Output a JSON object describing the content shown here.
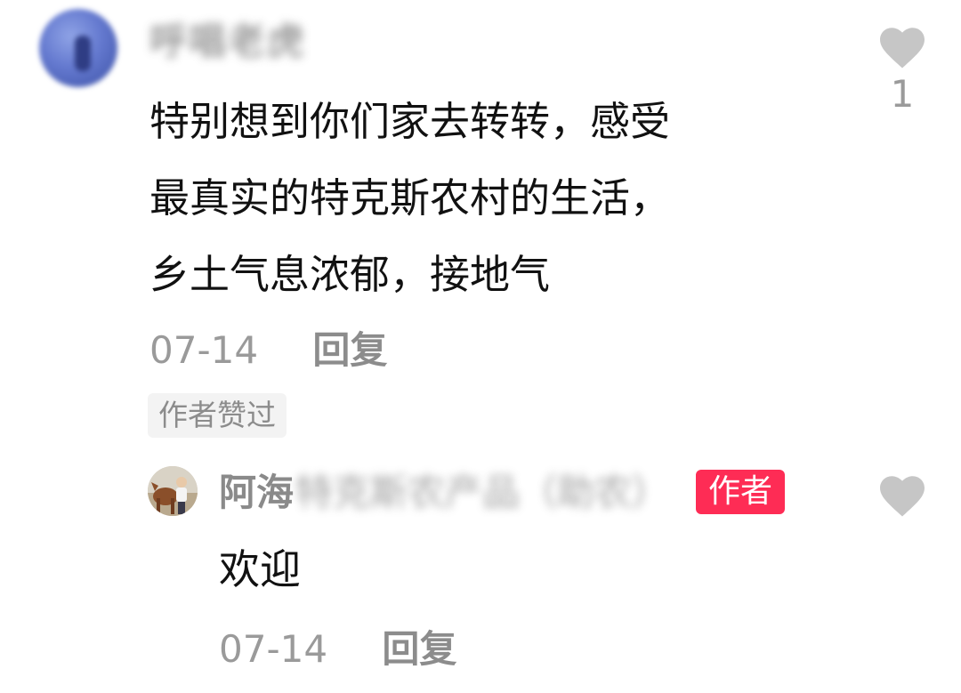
{
  "comment": {
    "username": "呼唱老虎",
    "content_lines": [
      "特别想到你们家去转转，感受",
      "最真实的特克斯农村的生活，",
      "乡土气息浓郁，接地气"
    ],
    "date": "07-14",
    "reply_label": "回复",
    "liked_by_author_label": "作者赞过",
    "like_count": "1",
    "like_icon": "heart-icon"
  },
  "reply": {
    "username": "阿海",
    "username_obscured": "特克斯农产品（助农）",
    "author_badge": "作者",
    "content": "欢迎",
    "date": "07-14",
    "reply_label": "回复",
    "like_icon": "heart-icon"
  },
  "colors": {
    "author_badge_bg": "#fe2c55",
    "muted_text": "#9a9a9a",
    "heart": "#c6c6c6"
  }
}
